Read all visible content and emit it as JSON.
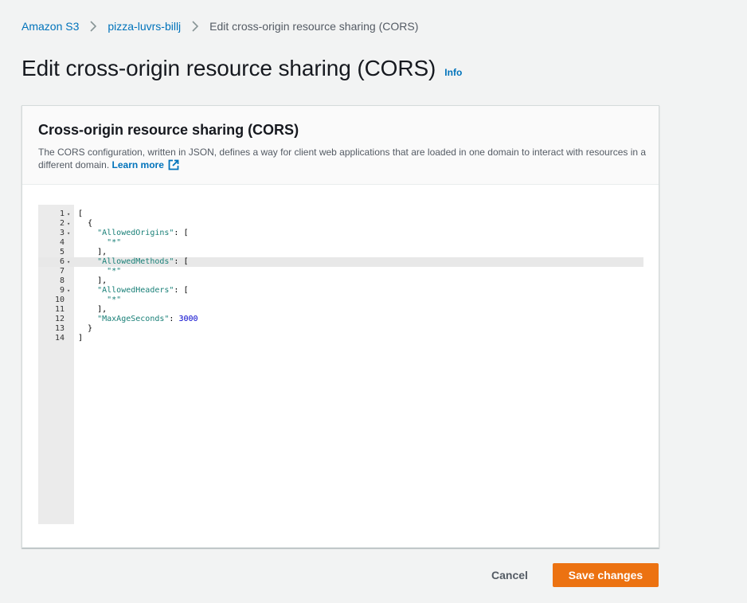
{
  "breadcrumb": {
    "items": [
      "Amazon S3",
      "pizza-luvrs-billj"
    ],
    "current": "Edit cross-origin resource sharing (CORS)"
  },
  "page": {
    "title": "Edit cross-origin resource sharing (CORS)",
    "info_label": "Info"
  },
  "panel": {
    "title": "Cross-origin resource sharing (CORS)",
    "description": "The CORS configuration, written in JSON, defines a way for client web applications that are loaded in one domain to interact with resources in a different domain.",
    "learn_more_label": "Learn more"
  },
  "editor": {
    "active_line": 6,
    "lines": [
      {
        "n": "1",
        "fold": true,
        "text": "["
      },
      {
        "n": "2",
        "fold": true,
        "text": "  {"
      },
      {
        "n": "3",
        "fold": true,
        "text": "    \"AllowedOrigins\": ["
      },
      {
        "n": "4",
        "fold": false,
        "text": "      \"*\""
      },
      {
        "n": "5",
        "fold": false,
        "text": "    ],"
      },
      {
        "n": "6",
        "fold": true,
        "text": "    \"AllowedMethods\": ["
      },
      {
        "n": "7",
        "fold": false,
        "text": "      \"*\""
      },
      {
        "n": "8",
        "fold": false,
        "text": "    ],"
      },
      {
        "n": "9",
        "fold": true,
        "text": "    \"AllowedHeaders\": ["
      },
      {
        "n": "10",
        "fold": false,
        "text": "      \"*\""
      },
      {
        "n": "11",
        "fold": false,
        "text": "    ],"
      },
      {
        "n": "12",
        "fold": false,
        "text": "    \"MaxAgeSeconds\": 3000"
      },
      {
        "n": "13",
        "fold": false,
        "text": "  }"
      },
      {
        "n": "14",
        "fold": false,
        "text": "]"
      }
    ]
  },
  "actions": {
    "cancel_label": "Cancel",
    "save_label": "Save changes"
  },
  "colors": {
    "link": "#0073bb",
    "primary_button": "#ec7211",
    "json_string": "#1a8078",
    "json_number": "#0000cd"
  },
  "icons": {
    "breadcrumb_separator": "chevron-right-icon",
    "learn_more": "external-link-icon",
    "fold": "fold-arrow-icon"
  }
}
